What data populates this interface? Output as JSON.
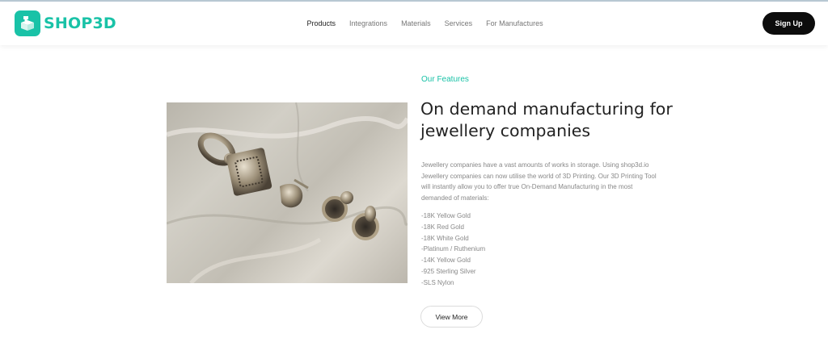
{
  "header": {
    "brand": "SHOP3D",
    "nav": [
      {
        "label": "Products",
        "active": true
      },
      {
        "label": "Integrations",
        "active": false
      },
      {
        "label": "Materials",
        "active": false
      },
      {
        "label": "Services",
        "active": false
      },
      {
        "label": "For Manufactures",
        "active": false
      }
    ],
    "signup_label": "Sign Up"
  },
  "feature": {
    "eyebrow": "Our Features",
    "title": "On demand manufacturing for jewellery companies",
    "description": "Jewellery companies have a vast amounts of works in storage. Using shop3d.io Jewellery companies can now utilise the world of 3D Printing. Our 3D Printing Tool will instantly allow you to offer true On-Demand Manufacturing in the most demanded of materials:",
    "materials": [
      "-18K Yellow Gold",
      "-18K Red Gold",
      "-18K White Gold",
      "-Platinum / Ruthenium",
      "-14K Yellow Gold",
      "-925 Sterling Silver",
      "-SLS Nylon"
    ],
    "cta_label": "View More"
  },
  "icons": {
    "logo": "printer-cube-icon"
  },
  "colors": {
    "accent": "#19c2a7",
    "button_dark": "#0d0d0d",
    "text_dark": "#222222",
    "text_muted": "#888888"
  }
}
